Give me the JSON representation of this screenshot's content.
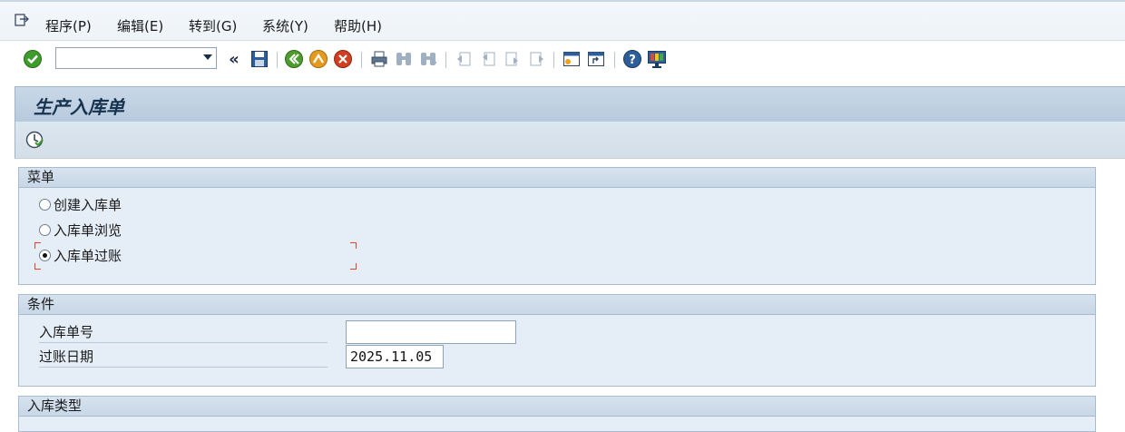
{
  "menubar": {
    "items": [
      "程序(P)",
      "编辑(E)",
      "转到(G)",
      "系统(Y)",
      "帮助(H)"
    ]
  },
  "toolbar": {
    "command_value": "",
    "icons": [
      "enter-icon",
      "back-icon",
      "save-icon",
      "back-green-icon",
      "exit-icon",
      "cancel-icon",
      "print-icon",
      "find-icon",
      "find-next-icon",
      "first-page-icon",
      "prev-page-icon",
      "next-page-icon",
      "last-page-icon",
      "new-session-icon",
      "shortcut-icon",
      "help-icon",
      "layout-icon"
    ]
  },
  "title": "生产入库单",
  "menu_frame": {
    "header": "菜单",
    "options": [
      {
        "label": "创建入库单",
        "checked": false
      },
      {
        "label": "入库单浏览",
        "checked": false
      },
      {
        "label": "入库单过账",
        "checked": true
      }
    ]
  },
  "conditions_frame": {
    "header": "条件",
    "fields": [
      {
        "label": "入库单号",
        "value": ""
      },
      {
        "label": "过账日期",
        "value": "2025.11.05"
      }
    ]
  },
  "type_frame": {
    "header": "入库类型"
  },
  "colors": {
    "title_text": "#17324f",
    "frame_bg": "#e5eef6",
    "focus": "#e0452a"
  }
}
